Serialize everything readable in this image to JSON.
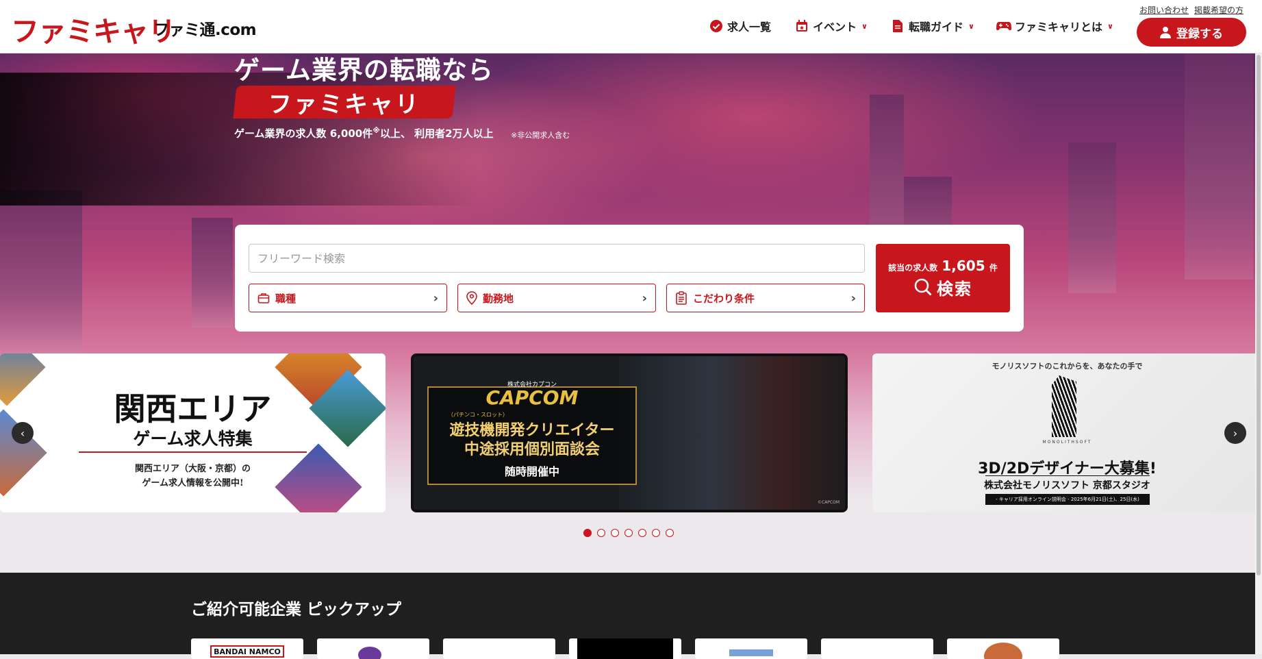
{
  "header": {
    "logo": "ファミキャリ",
    "sublogo": "ファミ通.com",
    "nav": [
      {
        "label": "求人一覧",
        "icon": "check-circle-icon",
        "dropdown": false
      },
      {
        "label": "イベント",
        "icon": "calendar-icon",
        "dropdown": true
      },
      {
        "label": "転職ガイド",
        "icon": "document-icon",
        "dropdown": true
      },
      {
        "label": "ファミキャリとは",
        "icon": "gamepad-icon",
        "dropdown": true
      }
    ],
    "links": [
      "お問い合わせ",
      "掲載希望の方"
    ],
    "register_label": "登録する"
  },
  "hero": {
    "headline": "ゲーム業界の転職なら",
    "brand": "ファミキャリ",
    "stats_prefix": "ゲーム業界の求人数 6,000件",
    "stats_mark": "※",
    "stats_suffix": "以上、 利用者2万人以上",
    "note": "※非公開求人含む"
  },
  "search": {
    "placeholder": "フリーワード検索",
    "filters": [
      {
        "label": "職種",
        "icon": "bag-icon"
      },
      {
        "label": "勤務地",
        "icon": "map-pin-icon"
      },
      {
        "label": "こだわり条件",
        "icon": "clipboard-icon"
      }
    ],
    "count_prefix": "該当の求人数",
    "count": "1,605",
    "count_suffix": "件",
    "button_label": "検索"
  },
  "carousel": {
    "slide1": {
      "title": "関西エリア",
      "subtitle": "ゲーム求人特集",
      "desc1": "関西エリア（大阪・京都）の",
      "desc2": "ゲーム求人情報を公開中!"
    },
    "slide2": {
      "small": "株式会社カプコン",
      "logo": "CAPCOM",
      "tag": "（パチンコ・スロット）",
      "line1": "遊技機開発クリエイター",
      "line2": "中途採用個別面談会",
      "line3": "随時開催中",
      "credit": "©CAPCOM"
    },
    "slide3": {
      "top": "モノリスソフトのこれからを、あなたの手で",
      "brand": "MONOLITHSOFT",
      "headline": "3D/2Dデザイナー大募集!",
      "company": "株式会社モノリスソフト 京都スタジオ",
      "event": "- キャリア採用オンライン説明会 - 2025年6月21日(土)、25日(水)"
    },
    "dot_count": 7,
    "active_dot": 0
  },
  "pickup": {
    "title": "ご紹介可能企業 ピックアップ",
    "companies": [
      "BANDAI NAMCO",
      "",
      "",
      "",
      "",
      "",
      ""
    ]
  }
}
